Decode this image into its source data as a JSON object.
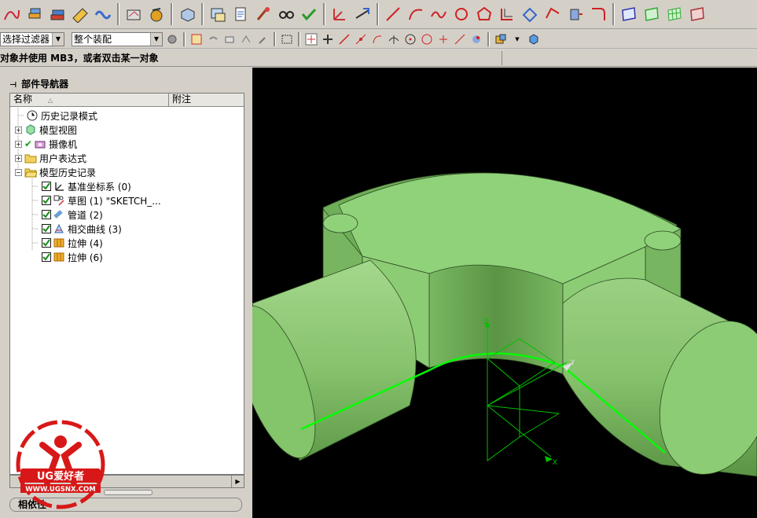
{
  "toolbar": {
    "filter_combo": "选择过滤器",
    "assembly_combo": "整个装配"
  },
  "status": {
    "prompt": "对象并使用 MB3，或者双击某一对象"
  },
  "navigator": {
    "title": "部件导航器",
    "col_name": "名称",
    "col_note": "附注",
    "items": [
      {
        "label": "历史记录模式",
        "icon": "clock-icon"
      },
      {
        "label": "模型视图",
        "icon": "model-view-icon"
      },
      {
        "label": "摄像机",
        "icon": "camera-icon"
      },
      {
        "label": "用户表达式",
        "icon": "folder-icon"
      },
      {
        "label": "模型历史记录",
        "icon": "folder-open-icon"
      }
    ],
    "features": [
      {
        "label": "基准坐标系 (0)",
        "icon": "datum-csys-icon"
      },
      {
        "label": "草图 (1) \"SKETCH_...",
        "icon": "sketch-icon"
      },
      {
        "label": "管道 (2)",
        "icon": "tube-icon"
      },
      {
        "label": "相交曲线 (3)",
        "icon": "intersection-curve-icon"
      },
      {
        "label": "拉伸 (4)",
        "icon": "extrude-icon"
      },
      {
        "label": "拉伸 (6)",
        "icon": "extrude-icon"
      }
    ],
    "bottom_tab": "相依性"
  },
  "viewport": {
    "axis_x": "X",
    "axis_y": "Y",
    "axis_z": "Z",
    "model_color": "#86c26c",
    "curve_color": "#00ff00"
  },
  "watermark": {
    "brand": "UG爱好者",
    "url": "WWW.UGSNX.COM"
  }
}
